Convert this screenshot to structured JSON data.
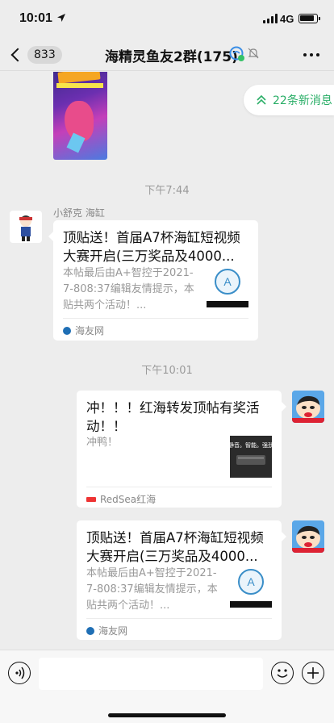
{
  "status_bar": {
    "time": "10:01",
    "network": "4G",
    "icons": [
      "location-arrow-icon",
      "signal-bars-icon",
      "battery-icon"
    ]
  },
  "nav": {
    "back_count": "833",
    "title": "海精灵鱼友2群(175)",
    "icons": [
      "back-chevron-icon",
      "group-verified-icon",
      "mute-bell-icon",
      "more-dots-icon"
    ]
  },
  "new_messages": {
    "label": "22条新消息",
    "accent": "#2aae67"
  },
  "messages": [
    {
      "type": "timestamp",
      "text": "下午7:44"
    },
    {
      "type": "link_card",
      "direction": "incoming",
      "sender": "小舒克 海缸",
      "title": "顶贴送！首届A7杯海缸短视频大赛开启(三万奖品及4000...",
      "description": "本帖最后由A+智控于2021-7-808:37编辑友情提示，本贴共两个活动！...",
      "source": "海友网"
    },
    {
      "type": "timestamp",
      "text": "下午10:01"
    },
    {
      "type": "link_card",
      "direction": "outgoing",
      "title": "冲！！！红海转发顶帖有奖活动！！",
      "description": "冲鸭！",
      "thumb_text": "静音。智能。强劲",
      "source": "RedSea红海"
    },
    {
      "type": "link_card",
      "direction": "outgoing",
      "title": "顶贴送！首届A7杯海缸短视频大赛开启(三万奖品及4000...",
      "description": "本帖最后由A+智控于2021-7-808:37编辑友情提示，本贴共两个活动！...",
      "source": "海友网"
    }
  ],
  "input_bar": {
    "icons": [
      "voice-icon",
      "emoji-icon",
      "plus-icon"
    ]
  },
  "colors": {
    "background": "#ededed",
    "card": "#ffffff",
    "accent_green": "#2aae67",
    "timestamp_gray": "#9a9a9a"
  }
}
